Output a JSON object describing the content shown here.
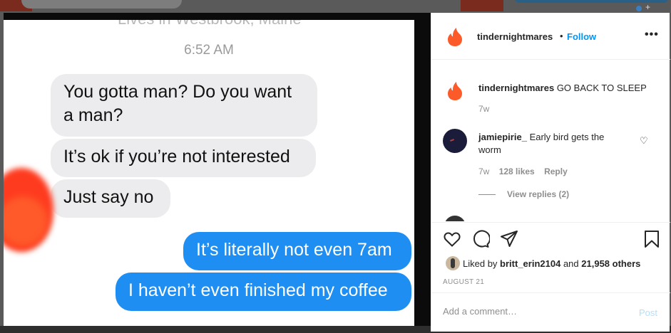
{
  "post_image": {
    "cut_top_text": "Lives in Westbrook, Maine",
    "time": "6:52 AM",
    "messages": [
      {
        "side": "received",
        "text": "You gotta man? Do you want a man?"
      },
      {
        "side": "received",
        "text": "It’s ok if you’re not interested"
      },
      {
        "side": "received",
        "text": "Just say no"
      },
      {
        "side": "sent",
        "text": "It’s literally not even 7am"
      },
      {
        "side": "sent",
        "text": "I haven’t even finished my coffee"
      }
    ]
  },
  "header": {
    "username": "tindernightmares",
    "dot": "•",
    "follow_label": "Follow",
    "more_icon": "more-options-icon",
    "more_glyph": "•••"
  },
  "caption": {
    "username": "tindernightmares",
    "text": "GO BACK TO SLEEP",
    "time": "7w"
  },
  "comment": {
    "username": "jamiepirie_",
    "text": "Early bird gets the worm",
    "time": "7w",
    "likes": "128 likes",
    "reply_label": "Reply",
    "heart_glyph": "♡"
  },
  "view_replies": "View replies (2)",
  "likes": {
    "prefix": "Liked by",
    "user": "britt_erin2104",
    "middle": "and",
    "others": "21,958 others"
  },
  "date": "AUGUST 21",
  "add_comment": {
    "placeholder": "Add a comment…",
    "post_label": "Post"
  },
  "colors": {
    "accent": "#0095f6",
    "imessage_blue": "#1e8ef3",
    "imessage_grey": "#ececee",
    "brand_flame": "#fd5a2a"
  }
}
